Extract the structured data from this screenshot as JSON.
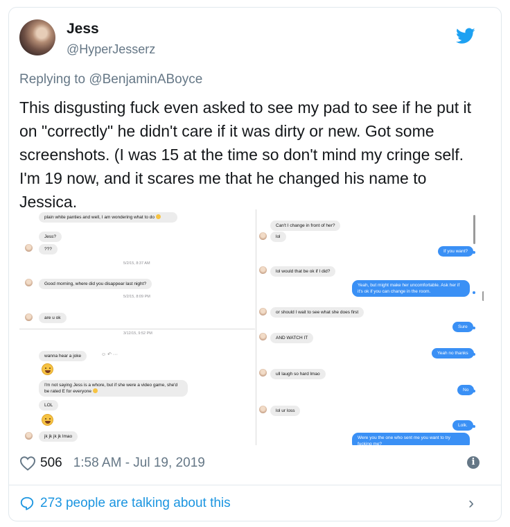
{
  "author": {
    "name": "Jess",
    "handle": "@HyperJesserz"
  },
  "reply": {
    "prefix": "Replying to ",
    "to": "@BenjaminABoyce"
  },
  "tweet": {
    "text": "This disgusting fuck even asked to see my pad to see if he put it on \"correctly\" he didn't care if it was dirty or new. Got some screenshots. (I was 15 at the time so don't mind my cringe self. I'm 19 now, and it scares me that he changed his name to Jessica."
  },
  "screenshot_messages": {
    "left": {
      "m1": "plain white panties and well, I am wondering what to do",
      "m2": "Jess?",
      "m3": "???",
      "ts1": "5/2/15, 8:37 AM",
      "m4": "Good morning, where did you disappear last night?",
      "ts2": "5/2/15, 8:09 PM",
      "m5": "are u ok",
      "ts3": "3/12/15, 9:52 PM",
      "m6": "wanna hear a joke",
      "m7": "I'm not saying Jess is a whore, but if she were a video game, she'd be rated E for everyone",
      "m8": "LOL",
      "m9": "jk jk jk jk lmao"
    },
    "right": {
      "r1": "Can't I change in front of her?",
      "r2": "lol",
      "r3": "If you want?",
      "r4": "lol would that be ok if I did?",
      "r5": "Yeah, but might make her uncomfortable. Ask her if it's ok if you can change in the room.",
      "r6": "or should I wait to see what she does first",
      "r7": "Sure",
      "r8": "AND WATCH IT",
      "r9": "Yeah no thanks",
      "r10": "ull laugh so hard lmao",
      "r11": "No",
      "r12": "lol ur loss",
      "r13": "Lolk.",
      "r14": "Were you the one who sent me you want to try fucking me?"
    }
  },
  "footer": {
    "likes": "506",
    "timestamp": "1:58 AM - Jul 19, 2019",
    "talking": "273 people are talking about this"
  },
  "colors": {
    "twitter_blue": "#1da1f2",
    "link_blue": "#1b95e0",
    "imessage_blue": "#3a90f5",
    "gray_text": "#657786"
  },
  "icons": [
    "twitter-bird-icon",
    "heart-icon",
    "info-icon",
    "speech-bubble-icon",
    "chevron-right-icon"
  ]
}
